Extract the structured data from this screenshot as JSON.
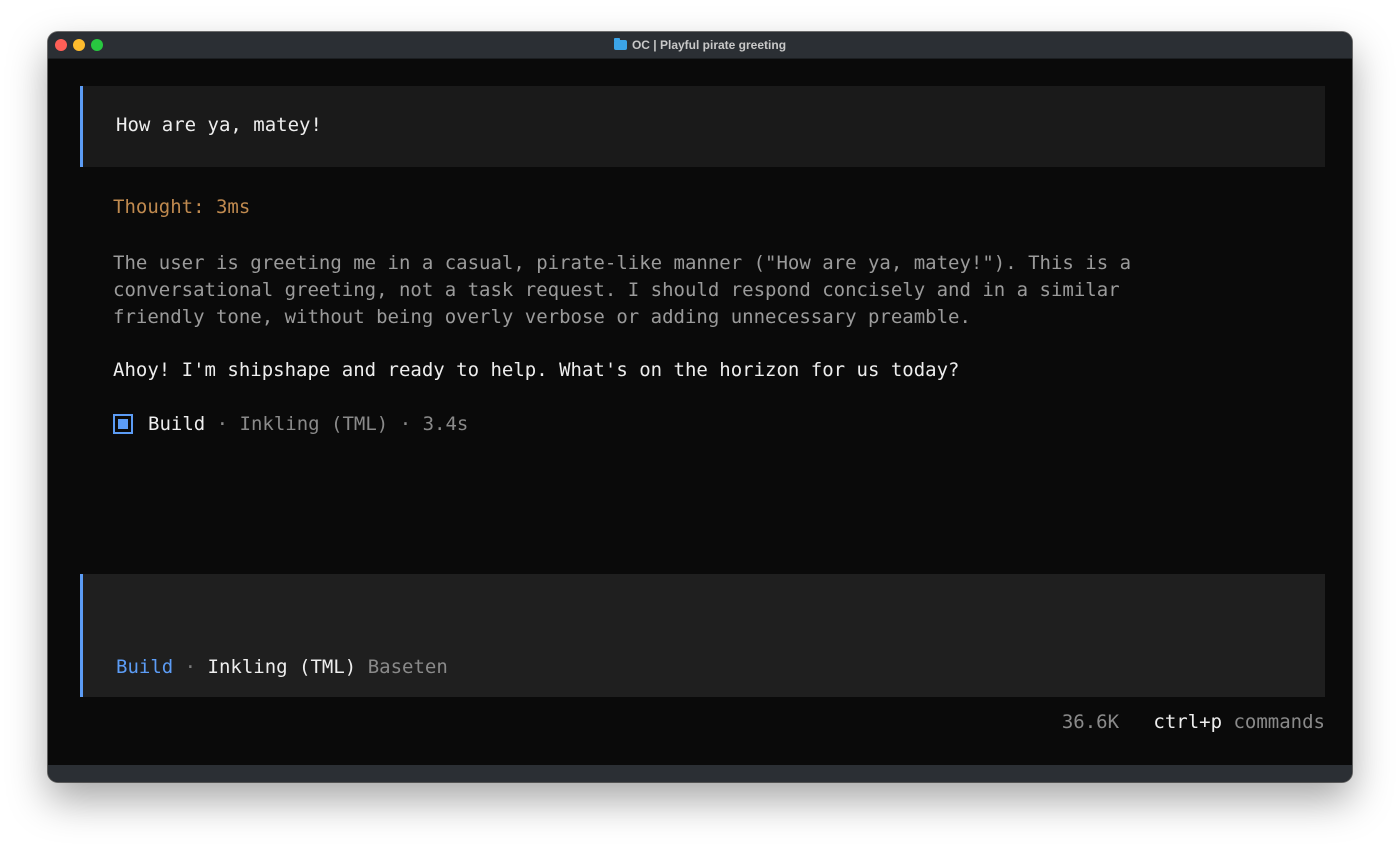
{
  "window": {
    "title": "OC | Playful pirate greeting"
  },
  "conversation": {
    "user_message": "How are ya, matey!",
    "thought_label": "Thought: 3ms",
    "reasoning_lines": [
      "The user is greeting me in a casual, pirate-like manner (\"How are ya, matey!\"). This is a",
      "conversational greeting, not a task request. I should respond concisely and in a similar",
      "friendly tone, without being overly verbose or adding unnecessary preamble."
    ],
    "assistant_reply": "Ahoy! I'm shipshape and ready to help. What's on the horizon for us today?",
    "status": {
      "agent": "Build",
      "separator": " · ",
      "model": "Inkling (TML)",
      "duration": "3.4s"
    }
  },
  "input": {
    "value": "",
    "placeholder": "",
    "mode": "Build",
    "separator": " · ",
    "model": "Inkling (TML)",
    "provider": "Baseten"
  },
  "footer": {
    "tokens": "36.6K",
    "shortcut": "ctrl+p",
    "shortcut_label": "commands"
  },
  "colors": {
    "accent": "#5c9cf5",
    "thought": "#c08a4f",
    "background": "#0a0a0a"
  }
}
